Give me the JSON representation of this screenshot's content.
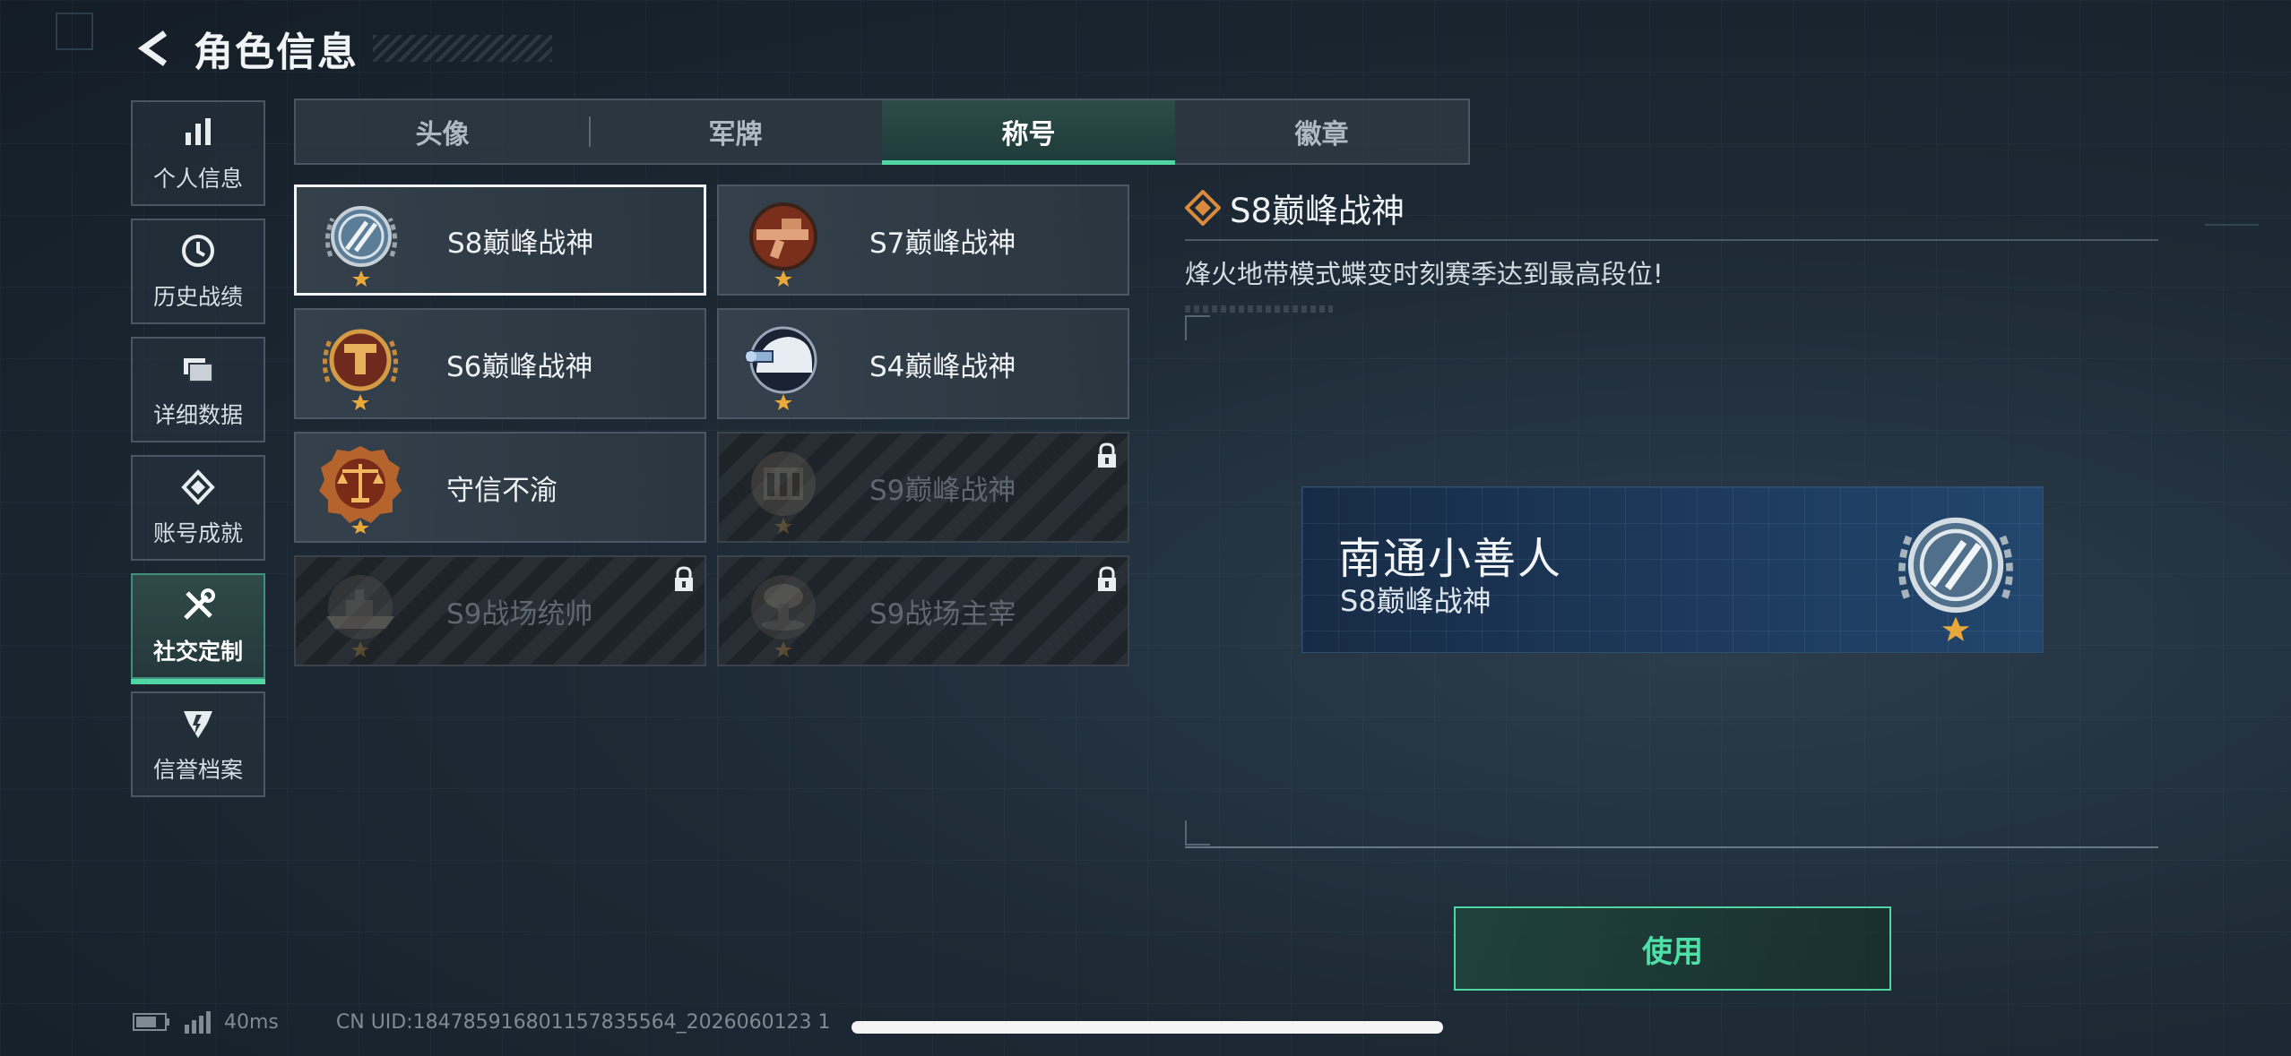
{
  "header": {
    "title": "角色信息",
    "back_icon": "back-arrow-icon"
  },
  "nav": {
    "items": [
      {
        "label": "个人信息",
        "icon": "bar-chart-icon",
        "active": false
      },
      {
        "label": "历史战绩",
        "icon": "clock-icon",
        "active": false
      },
      {
        "label": "详细数据",
        "icon": "folders-icon",
        "active": false
      },
      {
        "label": "账号成就",
        "icon": "achievement-icon",
        "active": false
      },
      {
        "label": "社交定制",
        "icon": "tools-icon",
        "active": true
      },
      {
        "label": "信誉档案",
        "icon": "credit-icon",
        "active": false
      }
    ]
  },
  "tabs": [
    {
      "label": "头像",
      "active": false
    },
    {
      "label": "军牌",
      "active": false
    },
    {
      "label": "称号",
      "active": true
    },
    {
      "label": "徽章",
      "active": false
    }
  ],
  "titles": [
    {
      "label": "S8巅峰战神",
      "locked": false,
      "selected": true,
      "medal": "s8-medal-icon"
    },
    {
      "label": "S7巅峰战神",
      "locked": false,
      "selected": false,
      "medal": "s7-medal-icon"
    },
    {
      "label": "S6巅峰战神",
      "locked": false,
      "selected": false,
      "medal": "s6-medal-icon"
    },
    {
      "label": "S4巅峰战神",
      "locked": false,
      "selected": false,
      "medal": "s4-medal-icon"
    },
    {
      "label": "守信不渝",
      "locked": false,
      "selected": false,
      "medal": "scales-medal-icon"
    },
    {
      "label": "S9巅峰战神",
      "locked": true,
      "selected": false,
      "medal": "s9-medal-icon"
    },
    {
      "label": "S9战场统帅",
      "locked": true,
      "selected": false,
      "medal": "ship-medal-icon"
    },
    {
      "label": "S9战场主宰",
      "locked": true,
      "selected": false,
      "medal": "explosion-medal-icon"
    }
  ],
  "detail": {
    "title": "S8巅峰战神",
    "description": "烽火地带模式蝶变时刻赛季达到最高段位!"
  },
  "nameplate": {
    "player_name": "南通小善人",
    "title": "S8巅峰战神"
  },
  "use_button": {
    "label": "使用"
  },
  "status_bar": {
    "ping": "40ms",
    "uid": "CN UID:184785916801157835564_2026060123 1"
  },
  "colors": {
    "accent": "#4fd6a2",
    "nameplate_bg": "#1d3a5c",
    "medal_bronze": "#b5642e"
  }
}
